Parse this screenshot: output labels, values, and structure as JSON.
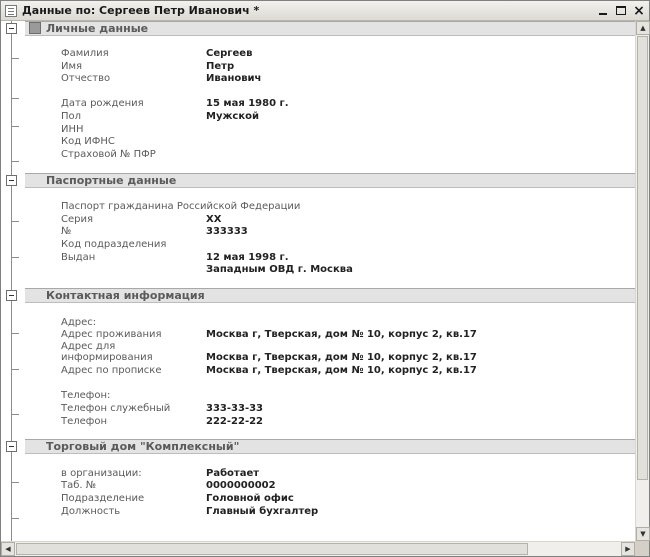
{
  "window": {
    "title": "Данные по: Сергеев Петр Иванович *",
    "buttons": {
      "minimize": "minimize",
      "maximize": "maximize",
      "close": "×"
    }
  },
  "groups": {
    "personal": {
      "title": "Личные данные",
      "rows": [
        {
          "label": "Фамилия",
          "value": "Сергеев"
        },
        {
          "label": "Имя",
          "value": "Петр"
        },
        {
          "label": "Отчество",
          "value": "Иванович"
        },
        {
          "label": "Дата рождения",
          "value": "15 мая 1980 г."
        },
        {
          "label": "Пол",
          "value": "Мужской"
        },
        {
          "label": "ИНН",
          "value": ""
        },
        {
          "label": "Код ИФНС",
          "value": ""
        },
        {
          "label": "Страховой № ПФР",
          "value": ""
        }
      ]
    },
    "passport": {
      "title": "Паспортные данные",
      "rows": [
        {
          "label": "Паспорт гражданина Российской Федерации",
          "value": ""
        },
        {
          "label": "Серия",
          "value": "XX"
        },
        {
          "label": "№",
          "value": "333333"
        },
        {
          "label": "Код подразделения",
          "value": ""
        },
        {
          "label": "Выдан",
          "value": "12 мая 1998 г."
        },
        {
          "label": "",
          "value": "Западным ОВД г. Москва"
        }
      ]
    },
    "contact": {
      "title": "Контактная информация",
      "rows": [
        {
          "label": "Адрес:",
          "value": ""
        },
        {
          "label": "Адрес проживания",
          "value": "Москва г, Тверская, дом № 10, корпус 2, кв.17"
        },
        {
          "label": "Адрес для",
          "value": ""
        },
        {
          "label": "информирования",
          "value": "Москва г, Тверская, дом № 10, корпус 2, кв.17"
        },
        {
          "label": "Адрес по прописке",
          "value": "Москва г, Тверская, дом № 10, корпус 2, кв.17"
        },
        {
          "label": "Телефон:",
          "value": ""
        },
        {
          "label": "Телефон служебный",
          "value": "333-33-33"
        },
        {
          "label": "Телефон",
          "value": "222-22-22"
        }
      ]
    },
    "employment": {
      "title": "Торговый дом \"Комплексный\"",
      "rows": [
        {
          "label": "в организации:",
          "value": "Работает"
        },
        {
          "label": "Таб. №",
          "value": "0000000002"
        },
        {
          "label": "Подразделение",
          "value": "Головной офис"
        },
        {
          "label": "Должность",
          "value": "Главный бухгалтер"
        }
      ]
    }
  },
  "scrollbars": {
    "up_arrow": "▲",
    "down_arrow": "▼",
    "left_arrow": "◀",
    "right_arrow": "▶"
  }
}
